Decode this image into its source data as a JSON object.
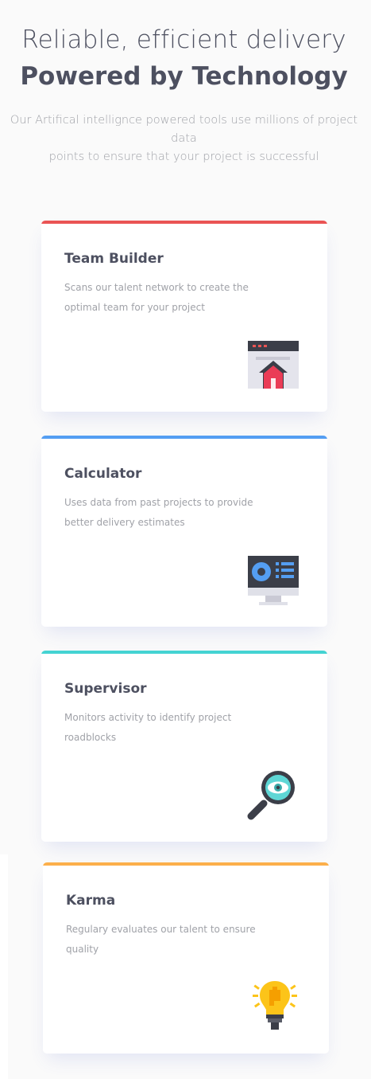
{
  "header": {
    "line1": "Reliable, efficient delivery",
    "line2": "Powered by Technology",
    "intro_lines": [
      "Our Artifical intellignce powered tools use millions of project data",
      "points to ensure that your project is successful"
    ]
  },
  "cards": [
    {
      "title": "Team Builder",
      "description": "Scans our talent network to create the optimal team for your project",
      "accent": "#ea5454",
      "icon": "team-builder-icon"
    },
    {
      "title": "Calculator",
      "description": "Uses data from past projects to provide better delivery estimates",
      "accent": "#549ef2",
      "icon": "calculator-icon"
    },
    {
      "title": "Supervisor",
      "description": "Monitors activity to identify project roadblocks",
      "accent": "#44d3d2",
      "icon": "supervisor-icon"
    },
    {
      "title": "Karma",
      "description": "Regulary evaluates our talent to ensure quality",
      "accent": "#fcaf4a",
      "icon": "karma-icon"
    }
  ]
}
